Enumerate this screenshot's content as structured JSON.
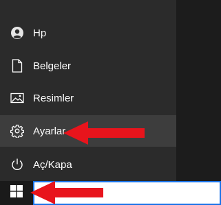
{
  "start_menu": {
    "items": [
      {
        "label": "Hp",
        "icon": "user-icon"
      },
      {
        "label": "Belgeler",
        "icon": "document-icon"
      },
      {
        "label": "Resimler",
        "icon": "pictures-icon"
      },
      {
        "label": "Ayarlar",
        "icon": "gear-icon",
        "selected": true
      },
      {
        "label": "Aç/Kapa",
        "icon": "power-icon"
      }
    ]
  },
  "taskbar": {
    "start_icon": "windows-logo-icon",
    "search_value": ""
  },
  "colors": {
    "panel_bg": "#2b2b2b",
    "selected_bg": "#3d3d3d",
    "text": "#ffffff",
    "arrow": "#e8141c",
    "search_border": "#1a73e8"
  },
  "annotations": {
    "arrow_icon": "red-arrow-icon"
  }
}
